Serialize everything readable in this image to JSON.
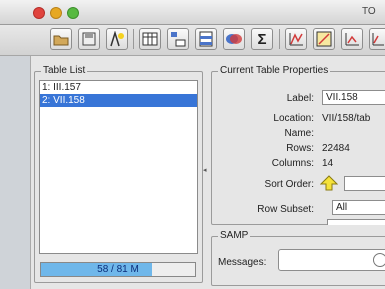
{
  "window": {
    "title": "TO"
  },
  "table_list": {
    "title": "Table List",
    "items": [
      {
        "label": "1: III.157",
        "selected": false
      },
      {
        "label": "2: VII.158",
        "selected": true
      }
    ]
  },
  "memory": {
    "text": "58 / 81 M",
    "used_fraction": 0.72
  },
  "props": {
    "title": "Current Table Properties",
    "label_label": "Label:",
    "label_value": "VII.158",
    "location_label": "Location:",
    "location_value": "VII/158/tab",
    "name_label": "Name:",
    "name_value": "",
    "rows_label": "Rows:",
    "rows_value": "22484",
    "columns_label": "Columns:",
    "columns_value": "14",
    "sort_label": "Sort Order:",
    "subset_label": "Row Subset:",
    "subset_value": "All"
  },
  "samp": {
    "title": "SAMP",
    "messages_label": "Messages:"
  },
  "toolbar_icons": [
    "load-table-icon",
    "save-table-icon",
    "concat-icon",
    "columns-icon",
    "parameters-icon",
    "subsets-icon",
    "match-icon",
    "stats-icon",
    "histogram-icon",
    "plot-icon",
    "plot-2-icon"
  ]
}
